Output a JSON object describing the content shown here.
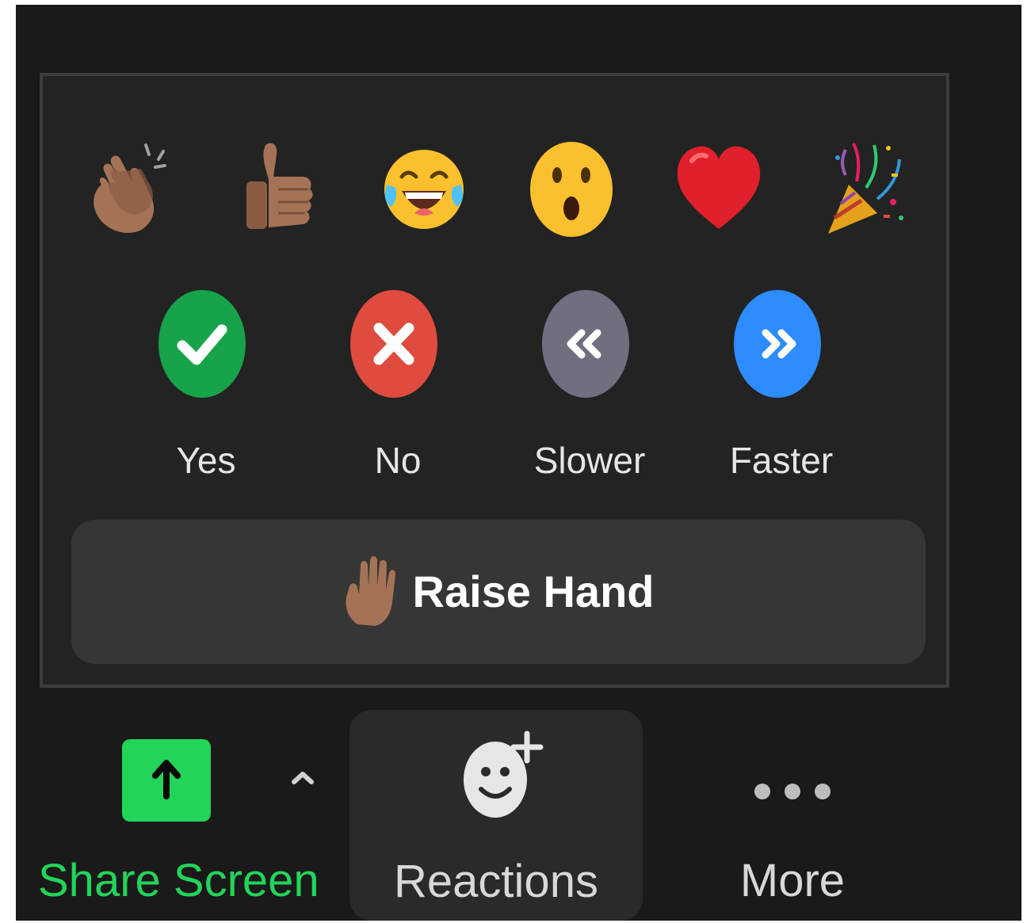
{
  "reactions": {
    "emojis": [
      {
        "name": "clapping-hands-icon"
      },
      {
        "name": "thumbs-up-icon"
      },
      {
        "name": "tears-of-joy-icon"
      },
      {
        "name": "open-mouth-icon"
      },
      {
        "name": "heart-icon"
      },
      {
        "name": "party-popper-icon"
      }
    ],
    "feedback": [
      {
        "label": "Yes",
        "icon": "check-icon",
        "color": "#17a34a"
      },
      {
        "label": "No",
        "icon": "x-icon",
        "color": "#e04b3f"
      },
      {
        "label": "Slower",
        "icon": "slower-icon",
        "color": "#6f6f80"
      },
      {
        "label": "Faster",
        "icon": "faster-icon",
        "color": "#2d8cff"
      }
    ],
    "raise_hand_label": "Raise Hand"
  },
  "toolbar": {
    "share_screen_label": "Share Screen",
    "reactions_label": "Reactions",
    "more_label": "More",
    "share_color": "#22d55a"
  }
}
